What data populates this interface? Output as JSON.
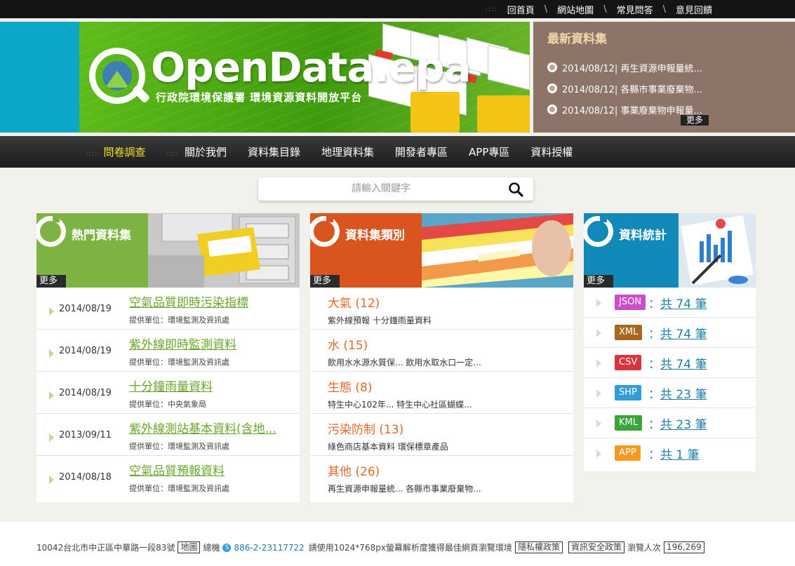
{
  "topbar": {
    "links": [
      "回首頁",
      "網站地圖",
      "常見問答",
      "意見回饋"
    ],
    "separator": "\\"
  },
  "banner": {
    "logo_title": "OpenData.epa",
    "logo_subtitle": "行政院環境保護署 環境資源資料開放平台"
  },
  "latest": {
    "title": "最新資料集",
    "items": [
      "2014/08/12| 再生資源申報量統...",
      "2014/08/12| 各縣市事業廢棄物...",
      "2014/08/12| 事業廢棄物申報量..."
    ],
    "more": "更多"
  },
  "nav": {
    "items": [
      "問卷調查",
      "關於我們",
      "資料集目錄",
      "地理資料集",
      "開發者專區",
      "APP專區",
      "資料授權"
    ]
  },
  "search": {
    "placeholder": "請輸入關鍵字"
  },
  "hot": {
    "title": "熱門資料集",
    "more": "更多",
    "rows": [
      {
        "date": "2014/08/19",
        "title": "空氣品質即時污染指標",
        "provider": "提供單位：環境監測及資訊處"
      },
      {
        "date": "2014/08/19",
        "title": "紫外線即時監測資料",
        "provider": "提供單位：環境監測及資訊處"
      },
      {
        "date": "2014/08/19",
        "title": "十分鐘雨量資料",
        "provider": "提供單位：中央氣象局"
      },
      {
        "date": "2013/09/11",
        "title": "紫外線測站基本資料(含地...",
        "provider": "提供單位：環境監測及資訊處"
      },
      {
        "date": "2014/08/18",
        "title": "空氣品質預報資料",
        "provider": "提供單位：環境監測及資訊處"
      }
    ]
  },
  "categories": {
    "title": "資料集類別",
    "more": "更多",
    "rows": [
      {
        "name": "大氣 (12)",
        "items": "紫外線預報 十分鐘雨量資料"
      },
      {
        "name": "水 (15)",
        "items": "飲用水水源水質保... 飲用水取水口一定..."
      },
      {
        "name": "生態 (8)",
        "items": "特生中心102年... 特生中心社區蝴蝶..."
      },
      {
        "name": "污染防制 (13)",
        "items": "綠色商店基本資料 環保標章產品"
      },
      {
        "name": "其他 (26)",
        "items": "再生資源申報量統... 各縣市事業廢棄物..."
      }
    ]
  },
  "stats": {
    "title": "資料統計",
    "more": "更多",
    "rows": [
      {
        "badge": "JSON",
        "color": "#c94fc9",
        "prefix": "：",
        "count": "共 74 筆"
      },
      {
        "badge": "XML",
        "color": "#a8671e",
        "prefix": "：",
        "count": "共 74 筆"
      },
      {
        "badge": "CSV",
        "color": "#d8343c",
        "prefix": "：",
        "count": "共 74 筆"
      },
      {
        "badge": "SHP",
        "color": "#2f9fd6",
        "prefix": "：",
        "count": "共 23 筆"
      },
      {
        "badge": "KML",
        "color": "#3aa63a",
        "prefix": "：",
        "count": "共 23 筆"
      },
      {
        "badge": "APP",
        "color": "#f39a1f",
        "prefix": "：",
        "count": "共 1 筆"
      }
    ]
  },
  "footer": {
    "address": "10042台北市中正區中華路一段83號",
    "map": "地圖",
    "phone_label": "總機",
    "phone": "886-2-23117722",
    "resolution_note": "請使用1024*768px螢幕解析度獲得最佳網頁瀏覽環境",
    "privacy": "隱私權政策",
    "security": "資訊安全政策",
    "visitors_label": "瀏覽人次",
    "visitors": "196,269"
  },
  "colors": {
    "hot_green": "#7cb342",
    "category_orange": "#d9541f",
    "stats_blue": "#1189b9"
  }
}
